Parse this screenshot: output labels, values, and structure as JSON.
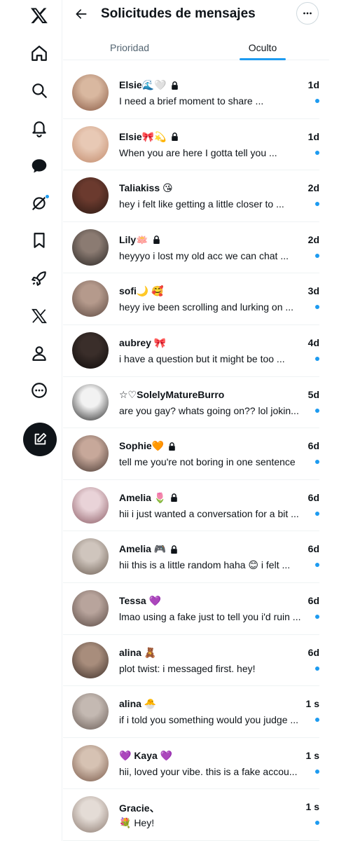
{
  "header": {
    "title": "Solicitudes de mensajes"
  },
  "tabs": [
    {
      "label": "Prioridad",
      "active": false
    },
    {
      "label": "Oculto",
      "active": true
    }
  ],
  "sidebar": {
    "icons": [
      "x-logo-icon",
      "home-icon",
      "search-icon",
      "notifications-icon",
      "messages-icon",
      "grok-icon",
      "bookmarks-icon",
      "rocket-icon",
      "x-premium-icon",
      "profile-icon",
      "more-icon",
      "compose-icon"
    ]
  },
  "colors": {
    "accent": "#1d9bf0",
    "text": "#0f1419",
    "muted": "#536471",
    "compose": "#0f1419"
  },
  "messages": [
    {
      "name": "Elsie🌊🤍",
      "locked": true,
      "preview": "I need a brief moment to share ...",
      "time": "1d",
      "unread": true,
      "avatar": [
        "#d9b8a0",
        "#8a5b45"
      ]
    },
    {
      "name": "Elsie🎀💫",
      "locked": true,
      "preview": "When you are here I gotta tell you ...",
      "time": "1d",
      "unread": true,
      "avatar": [
        "#e8c9b5",
        "#c28a6b"
      ]
    },
    {
      "name": "Taliakiss 😘",
      "locked": false,
      "preview": "hey i felt like getting a little closer to ...",
      "time": "2d",
      "unread": true,
      "avatar": [
        "#6b3a2e",
        "#2b1a14"
      ]
    },
    {
      "name": "Lily🪷",
      "locked": true,
      "preview": "heyyyo i lost my old acc we can chat ...",
      "time": "2d",
      "unread": true,
      "avatar": [
        "#8b7b72",
        "#2a2624"
      ]
    },
    {
      "name": "sofi🌙 🥰",
      "locked": false,
      "preview": "heyy ive been scrolling and lurking on ...",
      "time": "3d",
      "unread": true,
      "avatar": [
        "#b59a8c",
        "#5d4a42"
      ]
    },
    {
      "name": "aubrey 🎀",
      "locked": false,
      "preview": "i have a question but it might be too ...",
      "time": "4d",
      "unread": true,
      "avatar": [
        "#3a2e2a",
        "#0e0b0a"
      ]
    },
    {
      "name": "☆♡SolelyMatureBurro",
      "locked": false,
      "preview": "are you gay? whats going on?? lol jokin...",
      "time": "5d",
      "unread": true,
      "avatar": [
        "#f2f2f2",
        "#2a2a2a"
      ]
    },
    {
      "name": "Sophie🧡",
      "locked": true,
      "preview": "tell me you're not boring in one sentence",
      "time": "6d",
      "unread": true,
      "avatar": [
        "#c7a89a",
        "#4a3a34"
      ]
    },
    {
      "name": "Amelia 🌷",
      "locked": true,
      "preview": "hii i just wanted a conversation for a bit ...",
      "time": "6d",
      "unread": true,
      "avatar": [
        "#e9d3d8",
        "#8b5a63"
      ]
    },
    {
      "name": "Amelia 🎮",
      "locked": true,
      "preview": "hii this is a little random haha 😊 i felt ...",
      "time": "6d",
      "unread": true,
      "avatar": [
        "#cfc5bd",
        "#6d5f54"
      ]
    },
    {
      "name": "Tessa 💜",
      "locked": false,
      "preview": "lmao using a fake just to tell you i'd ruin ...",
      "time": "6d",
      "unread": true,
      "avatar": [
        "#b8a49c",
        "#5a4a44"
      ]
    },
    {
      "name": "alina 🧸",
      "locked": false,
      "preview": "plot twist: i messaged first. hey!",
      "time": "6d",
      "unread": true,
      "avatar": [
        "#a88d7c",
        "#3e302a"
      ]
    },
    {
      "name": "alina 🐣",
      "locked": false,
      "preview": "if i told you something would you judge ...",
      "time": "1 s",
      "unread": true,
      "avatar": [
        "#c4b9b2",
        "#6a5d57"
      ]
    },
    {
      "name": "💜 Kaya 💜",
      "locked": false,
      "preview": "hii, loved your vibe. this is a fake accou...",
      "time": "1 s",
      "unread": true,
      "avatar": [
        "#d6c2b3",
        "#7a5a4a"
      ]
    },
    {
      "name": "Gracie、",
      "locked": false,
      "preview": "💐 Hey!",
      "time": "1 s",
      "unread": true,
      "avatar": [
        "#e4dcd6",
        "#8c7a70"
      ]
    }
  ]
}
